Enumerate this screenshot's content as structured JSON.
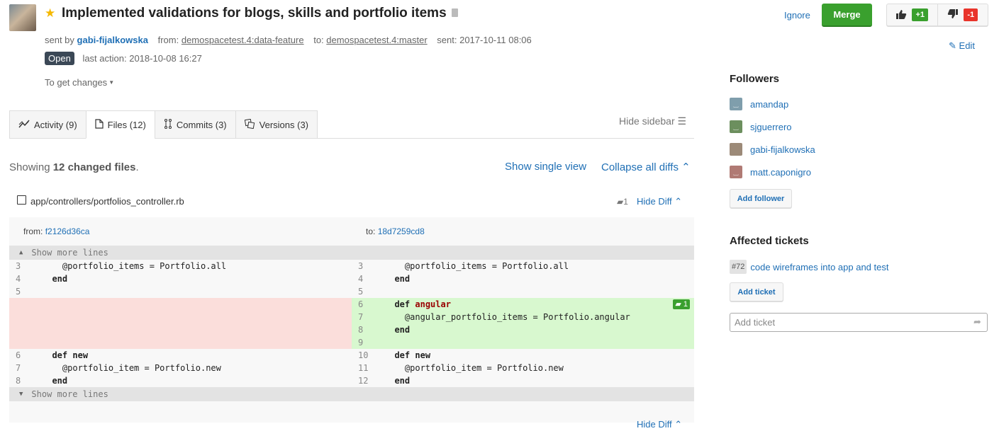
{
  "header": {
    "title": "Implemented validations for blogs, skills and portfolio items",
    "starred": true,
    "sent_by_label": "sent by",
    "author": "gabi-fijalkowska",
    "from_label": "from:",
    "from_branch": "demospacetest.4:data-feature",
    "to_label": "to:",
    "to_branch": "demospacetest.4:master",
    "sent_label": "sent:",
    "sent_date": "2017-10-11 08:06",
    "status": "Open",
    "last_action_label": "last action:",
    "last_action": "2018-10-08 16:27",
    "get_changes": "To get changes"
  },
  "actions": {
    "ignore": "Ignore",
    "merge": "Merge",
    "vote_up": "+1",
    "vote_down": "-1",
    "edit": "Edit"
  },
  "tabs": [
    {
      "label": "Activity (9)",
      "icon": "activity-icon"
    },
    {
      "label": "Files (12)",
      "icon": "file-icon",
      "active": true
    },
    {
      "label": "Commits (3)",
      "icon": "commits-icon"
    },
    {
      "label": "Versions (3)",
      "icon": "versions-icon"
    }
  ],
  "hide_sidebar": "Hide sidebar",
  "files_summary": {
    "prefix": "Showing",
    "count": "12 changed files",
    "suffix": "."
  },
  "show_single_view": "Show single view",
  "collapse_all": "Collapse all diffs",
  "file": {
    "path": "app/controllers/portfolios_controller.rb",
    "comment_count": "1",
    "hide_diff": "Hide Diff",
    "from_label": "from:",
    "from_sha": "f2126d36ca",
    "to_label": "to:",
    "to_sha": "18d7259cd8",
    "show_more": "Show more lines",
    "rows": [
      {
        "l_num": "3",
        "l_code": "    @portfolio_items = Portfolio.all",
        "r_num": "3",
        "r_code": "    @portfolio_items = Portfolio.all"
      },
      {
        "l_num": "4",
        "l_code": "  end",
        "r_num": "4",
        "r_code": "  end"
      },
      {
        "l_num": "5",
        "l_code": "",
        "r_num": "5",
        "r_code": ""
      },
      {
        "l_num": "",
        "l_code": "",
        "r_num": "6",
        "r_code": "  def angular",
        "comment": "1"
      },
      {
        "l_num": "",
        "l_code": "",
        "r_num": "7",
        "r_code": "    @angular_portfolio_items = Portfolio.angular"
      },
      {
        "l_num": "",
        "l_code": "",
        "r_num": "8",
        "r_code": "  end"
      },
      {
        "l_num": "",
        "l_code": "",
        "r_num": "9",
        "r_code": ""
      },
      {
        "l_num": "6",
        "l_code": "  def new",
        "r_num": "10",
        "r_code": "  def new"
      },
      {
        "l_num": "7",
        "l_code": "    @portfolio_item = Portfolio.new",
        "r_num": "11",
        "r_code": "    @portfolio_item = Portfolio.new"
      },
      {
        "l_num": "8",
        "l_code": "  end",
        "r_num": "12",
        "r_code": "  end"
      }
    ]
  },
  "sidebar": {
    "followers_title": "Followers",
    "followers": [
      {
        "name": "amandap",
        "color": "#7f9eac"
      },
      {
        "name": "sjguerrero",
        "color": "#6c8f5e"
      },
      {
        "name": "gabi-fijalkowska",
        "color": "#9c8a78"
      },
      {
        "name": "matt.caponigro",
        "color": "#b07a74"
      }
    ],
    "add_follower": "Add follower",
    "tickets_title": "Affected tickets",
    "ticket": {
      "num": "#72",
      "title": "code wireframes into app and test"
    },
    "add_ticket": "Add ticket",
    "ticket_input_placeholder": "Add ticket"
  }
}
